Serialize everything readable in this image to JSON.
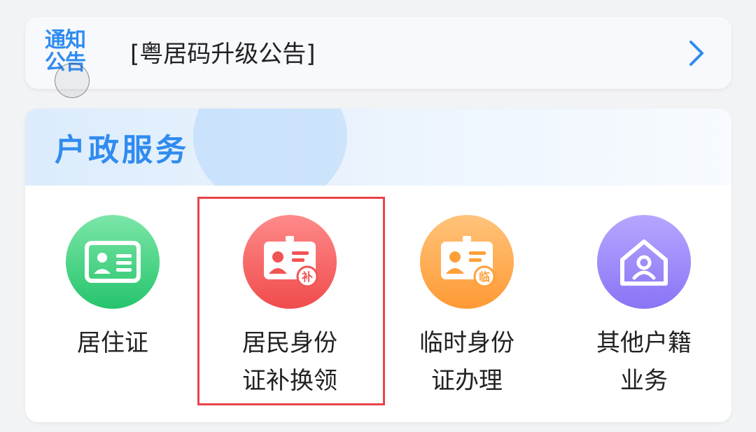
{
  "notice": {
    "badge_line1": "通知",
    "badge_line2": "公告",
    "text": "[粤居码升级公告]"
  },
  "section": {
    "title": "户政服务",
    "services": [
      {
        "label_line1": "居住证",
        "label_line2": "",
        "icon": "residence-card-icon",
        "color": "#2cc872"
      },
      {
        "label_line1": "居民身份",
        "label_line2": "证补换领",
        "icon": "id-card-reissue-icon",
        "badge": "补",
        "color": "#f25454"
      },
      {
        "label_line1": "临时身份",
        "label_line2": "证办理",
        "icon": "temp-id-card-icon",
        "badge": "临",
        "color": "#ff9f3a"
      },
      {
        "label_line1": "其他户籍",
        "label_line2": "业务",
        "icon": "house-person-icon",
        "color": "#907cf6"
      }
    ]
  },
  "colors": {
    "accent": "#2f8bf0",
    "highlight": "#e9434a"
  }
}
